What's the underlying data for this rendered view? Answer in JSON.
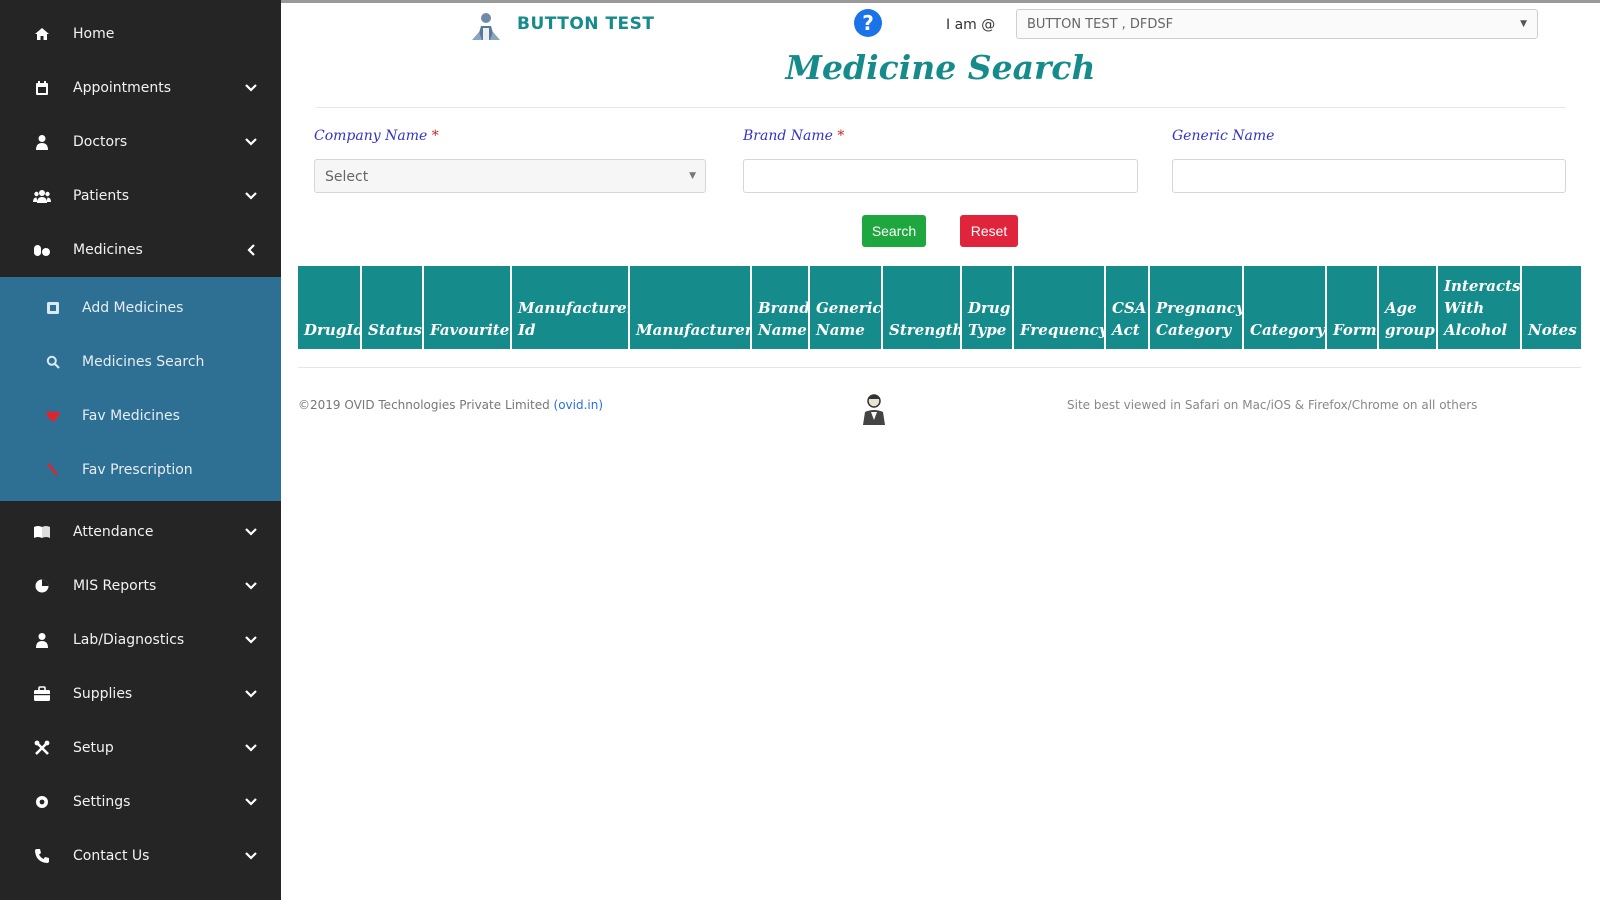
{
  "sidebar": {
    "items_top": [
      {
        "label": "Home",
        "icon": "home-icon"
      },
      {
        "label": "Appointments",
        "icon": "calendar-icon",
        "chevron": "down"
      },
      {
        "label": "Doctors",
        "icon": "doctor-icon",
        "chevron": "down"
      },
      {
        "label": "Patients",
        "icon": "patients-icon",
        "chevron": "down"
      },
      {
        "label": "Medicines",
        "icon": "pills-icon",
        "chevron": "left"
      }
    ],
    "submenu": [
      {
        "label": "Add Medicines",
        "icon": "plus-square-icon"
      },
      {
        "label": "Medicines Search",
        "icon": "search-icon"
      },
      {
        "label": "Fav Medicines",
        "icon": "heart-icon"
      },
      {
        "label": "Fav Prescription",
        "icon": "prescription-icon"
      }
    ],
    "items_bottom": [
      {
        "label": "Attendance",
        "icon": "book-icon",
        "chevron": "down"
      },
      {
        "label": "MIS Reports",
        "icon": "report-icon",
        "chevron": "down"
      },
      {
        "label": "Lab/Diagnostics",
        "icon": "lab-icon",
        "chevron": "down"
      },
      {
        "label": "Supplies",
        "icon": "briefcase-icon",
        "chevron": "down"
      },
      {
        "label": "Setup",
        "icon": "tools-icon",
        "chevron": "down"
      },
      {
        "label": "Settings",
        "icon": "gear-icon",
        "chevron": "down"
      },
      {
        "label": "Contact Us",
        "icon": "phone-icon",
        "chevron": "down"
      }
    ],
    "bg_color": "#252525",
    "submenu_bg_color": "#2e6f94"
  },
  "header": {
    "app_name": "BUTTON TEST",
    "help_glyph": "?",
    "iam_label": "I am @",
    "iam_value": "BUTTON TEST , DFDSF",
    "accent_color": "#168b8c"
  },
  "page": {
    "title": "Medicine Search"
  },
  "form": {
    "company_label": "Company Name",
    "company_required": "*",
    "company_value": "Select",
    "brand_label": "Brand Name",
    "brand_required": "*",
    "brand_value": "",
    "generic_label": "Generic Name",
    "generic_value": "",
    "search_label": "Search",
    "reset_label": "Reset"
  },
  "table": {
    "columns": [
      "DrugId",
      "Status",
      "Favourite",
      "Manufacturer Id",
      "Manufacturer",
      "Brand Name",
      "Generic Name",
      "Strength",
      "Drug Type",
      "Frequency",
      "CSA Act",
      "Pregnancy Category",
      "Category",
      "Form",
      "Age group",
      "Interacts With Alcohol",
      "Notes"
    ]
  },
  "footer": {
    "copyright": "©2019 OVID Technologies Private Limited",
    "link_text": "(ovid.in)",
    "best_viewed": "Site best viewed in Safari on Mac/iOS & Firefox/Chrome on all others"
  }
}
